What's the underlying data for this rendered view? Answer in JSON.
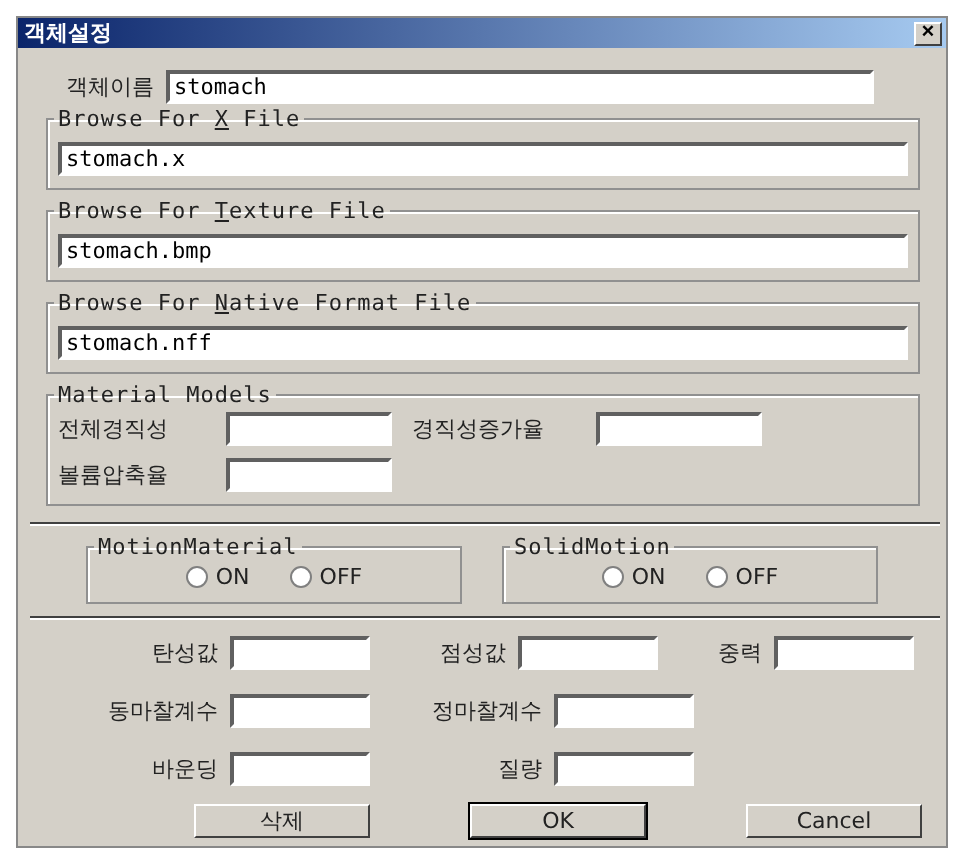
{
  "window": {
    "title": "객체설정",
    "close": "×"
  },
  "object_name": {
    "label": "객체이름",
    "value": "stomach"
  },
  "file_groups": [
    {
      "before": "Browse For ",
      "key": "X",
      "after": " File",
      "value": "stomach.x"
    },
    {
      "before": "Browse For ",
      "key": "T",
      "after": "exture File",
      "value": "stomach.bmp"
    },
    {
      "before": "Browse For ",
      "key": "N",
      "after": "ative Format File",
      "value": "stomach.nff"
    }
  ],
  "material_models": {
    "title": "Material Models",
    "rows": [
      [
        {
          "label": "전체경직성"
        },
        {
          "label": "경직성증가율"
        }
      ],
      [
        {
          "label": "볼륨압축율"
        }
      ]
    ]
  },
  "motion_groups": [
    {
      "title": "MotionMaterial",
      "options": [
        {
          "label": "ON",
          "selected": false
        },
        {
          "label": "OFF",
          "selected": false
        }
      ]
    },
    {
      "title": "SolidMotion",
      "options": [
        {
          "label": "ON",
          "selected": false
        },
        {
          "label": "OFF",
          "selected": false
        }
      ]
    }
  ],
  "properties": [
    [
      {
        "label": "탄성값"
      },
      {
        "label": "점성값"
      },
      {
        "label": "중력"
      }
    ],
    [
      {
        "label": "동마찰계수"
      },
      {
        "label": "정마찰계수"
      }
    ],
    [
      {
        "label": "바운딩"
      },
      {
        "label": "질량"
      }
    ]
  ],
  "buttons": [
    {
      "label": "삭제",
      "default": false
    },
    {
      "label": "OK",
      "default": true
    },
    {
      "label": "Cancel",
      "default": false
    }
  ]
}
